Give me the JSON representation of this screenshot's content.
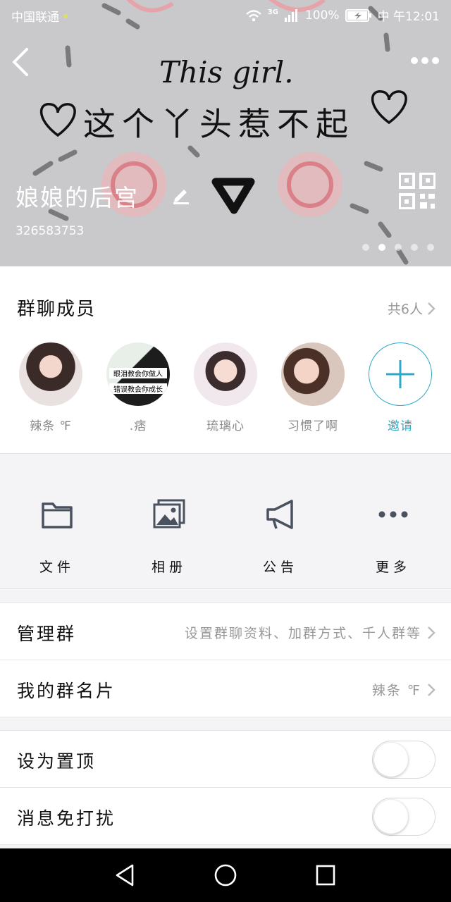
{
  "status_bar": {
    "carrier": "中国联通",
    "network": "3G",
    "battery": "100%",
    "time": "中 午12:01"
  },
  "header": {
    "banner_text_line1": "This girl.",
    "banner_text_line2": "这个丫头惹不起",
    "group_name": "娘娘的后宫",
    "group_number": "326583753",
    "carousel": {
      "count": 5,
      "active_index": 1
    }
  },
  "members_section": {
    "title": "群聊成员",
    "count_label": "共6人",
    "avatar_text": [
      "眼泪教会你做人",
      "错误教会你成长"
    ],
    "members": [
      {
        "name": "辣条 ℉"
      },
      {
        "name": ".痞"
      },
      {
        "name": "琉璃心"
      },
      {
        "name": "习惯了啊"
      }
    ],
    "invite_label": "邀请"
  },
  "actions": [
    {
      "label": "文件",
      "icon": "folder-icon"
    },
    {
      "label": "相册",
      "icon": "album-icon"
    },
    {
      "label": "公告",
      "icon": "megaphone-icon"
    },
    {
      "label": "更多",
      "icon": "more-dots-icon"
    }
  ],
  "settings": {
    "manage_group": {
      "label": "管理群",
      "value": "设置群聊资料、加群方式、千人群等"
    },
    "my_card": {
      "label": "我的群名片",
      "value": "辣条 ℉"
    },
    "pin_top": {
      "label": "设为置顶",
      "on": false
    },
    "mute": {
      "label": "消息免打扰",
      "on": false
    }
  },
  "colors": {
    "accent": "#2fa9c6",
    "banner_bg": "#c9c9cc",
    "page_bg": "#f4f4f6"
  }
}
